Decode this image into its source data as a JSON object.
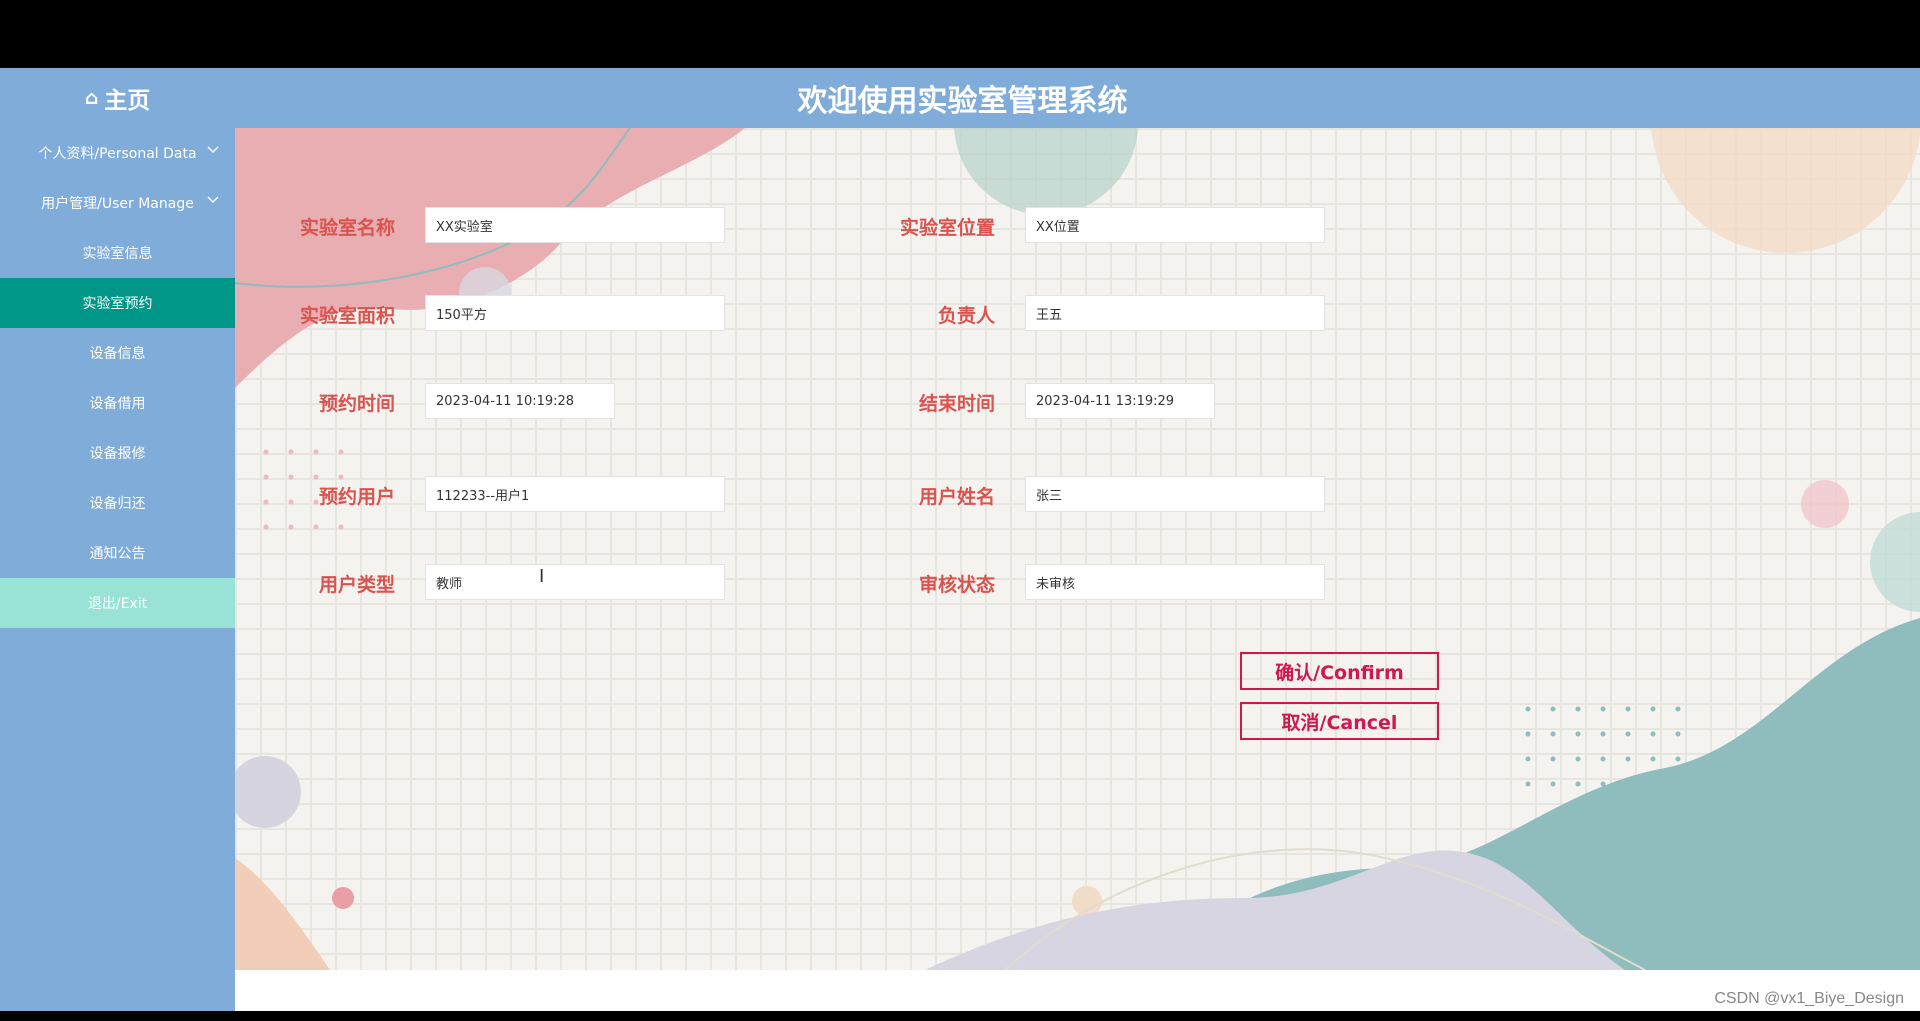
{
  "app": {
    "home_label": "主页",
    "title": "欢迎使用实验室管理系统"
  },
  "sidebar": {
    "items": [
      {
        "label": "个人资料/Personal Data",
        "expandable": true,
        "active": false
      },
      {
        "label": "用户管理/User Manage",
        "expandable": true,
        "active": false
      },
      {
        "label": "实验室信息",
        "expandable": false,
        "active": false
      },
      {
        "label": "实验室预约",
        "expandable": false,
        "active": true
      },
      {
        "label": "设备信息",
        "expandable": false,
        "active": false
      },
      {
        "label": "设备借用",
        "expandable": false,
        "active": false
      },
      {
        "label": "设备报修",
        "expandable": false,
        "active": false
      },
      {
        "label": "设备归还",
        "expandable": false,
        "active": false
      },
      {
        "label": "通知公告",
        "expandable": false,
        "active": false
      },
      {
        "label": "退出/Exit",
        "expandable": false,
        "active": false
      }
    ]
  },
  "form": {
    "lab_name": {
      "label": "实验室名称",
      "value": "XX实验室"
    },
    "lab_location": {
      "label": "实验室位置",
      "value": "XX位置"
    },
    "lab_area": {
      "label": "实验室面积",
      "value": "150平方"
    },
    "manager": {
      "label": "负责人",
      "value": "王五"
    },
    "start_time": {
      "label": "预约时间",
      "value": "2023-04-11 10:19:28"
    },
    "end_time": {
      "label": "结束时间",
      "value": "2023-04-11 13:19:29"
    },
    "booking_user": {
      "label": "预约用户",
      "value": "112233--用户1"
    },
    "user_name": {
      "label": "用户姓名",
      "value": "张三"
    },
    "user_type": {
      "label": "用户类型",
      "value": "教师"
    },
    "review_status": {
      "label": "审核状态",
      "value": "未审核"
    }
  },
  "buttons": {
    "confirm": "确认/Confirm",
    "cancel": "取消/Cancel"
  },
  "watermark": "CSDN @vx1_Biye_Design",
  "colors": {
    "sidebar_bg": "#80acd9",
    "active_item": "#009688",
    "exit_item": "#98e3d5",
    "label_red": "#d9534f",
    "button_red": "#d0174f"
  },
  "icons": {
    "home": "home-icon",
    "chevron": "chevron-down-icon",
    "cursor": "text-cursor-icon"
  }
}
